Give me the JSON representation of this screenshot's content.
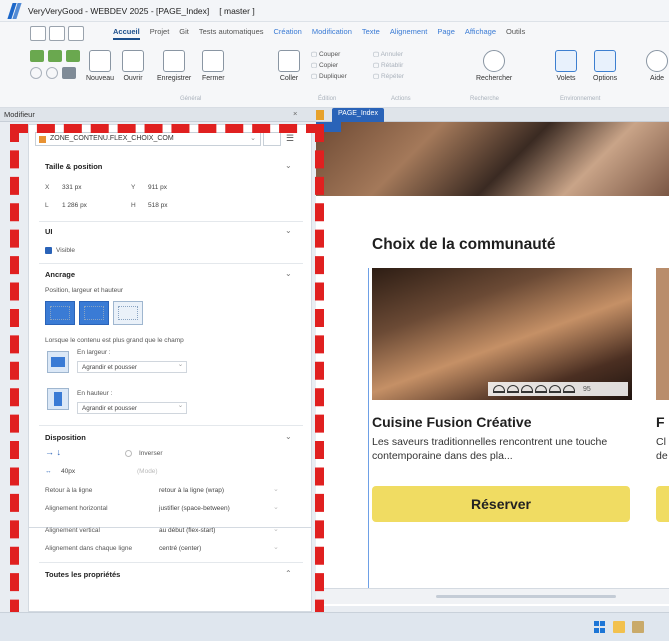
{
  "window": {
    "title": "VeryVeryGood - WEBDEV 2025 - [PAGE_Index]",
    "branch": "[ master ]"
  },
  "ribbon": {
    "tabs": [
      "Accueil",
      "Projet",
      "Git",
      "Tests automatiques",
      "Création",
      "Modification",
      "Texte",
      "Alignement",
      "Page",
      "Affichage",
      "Outils"
    ],
    "active_tab": "Accueil",
    "buttons": {
      "nouveau": "Nouveau",
      "ouvrir": "Ouvrir",
      "enregistrer": "Enregistrer",
      "fermer": "Fermer",
      "coller": "Coller",
      "rechercher": "Rechercher",
      "volets": "Volets",
      "options": "Options",
      "aide": "Aide"
    },
    "edit_col": [
      "Couper",
      "Copier",
      "Dupliquer"
    ],
    "undo_col": [
      "Annuler",
      "Rétablir",
      "Répéter"
    ],
    "groups": {
      "general": "Général",
      "edition": "Édition",
      "actions": "Actions",
      "recherche": "Recherche",
      "environnement": "Environnement"
    }
  },
  "panel": {
    "title": "Modifieur",
    "close": "×",
    "doc_tab": "PAGE_Index",
    "selector": "ZONE_CONTENU.FLEX_CHOIX_COM",
    "size_section": "Taille & position",
    "x_label": "X",
    "x_value": "331 px",
    "y_label": "Y",
    "y_value": "911 px",
    "l_label": "L",
    "l_value": "1 286 px",
    "h_label": "H",
    "h_value": "518 px",
    "ui_section": "UI",
    "visible_label": "Visible",
    "anchor_section": "Ancrage",
    "anchor_sub": "Position, largeur et hauteur",
    "overflow_text": "Lorsque le contenu est plus grand que le champ",
    "width_label": "En largeur :",
    "width_value": "Agrandir et pousser",
    "height_label": "En hauteur :",
    "height_value": "Agrandir et pousser",
    "layout_section": "Disposition",
    "invert_label": "Inverser",
    "gap_value": "40px",
    "mode_value": "(Mode)",
    "props": [
      {
        "label": "Retour à la ligne",
        "value": "retour à la ligne (wrap)"
      },
      {
        "label": "Alignement horizontal",
        "value": "justifier (space-between)"
      },
      {
        "label": "Alignement vertical",
        "value": "au début (flex-start)"
      },
      {
        "label": "Alignement dans chaque ligne",
        "value": "centré (center)"
      }
    ],
    "all_props": "Toutes les propriétés"
  },
  "preview": {
    "page_label": "Page",
    "section_title": "Choix de la communauté",
    "card1": {
      "title": "Cuisine Fusion Créative",
      "desc": "Les saveurs traditionnelles rencontrent une touche contemporaine dans des pla...",
      "rating_count": "95",
      "button": "Réserver"
    },
    "card2": {
      "title": "F",
      "desc": "Cl de"
    }
  },
  "colors": {
    "accent": "#2a63b8",
    "cta": "#f0dc62",
    "annotation": "#e02020"
  }
}
